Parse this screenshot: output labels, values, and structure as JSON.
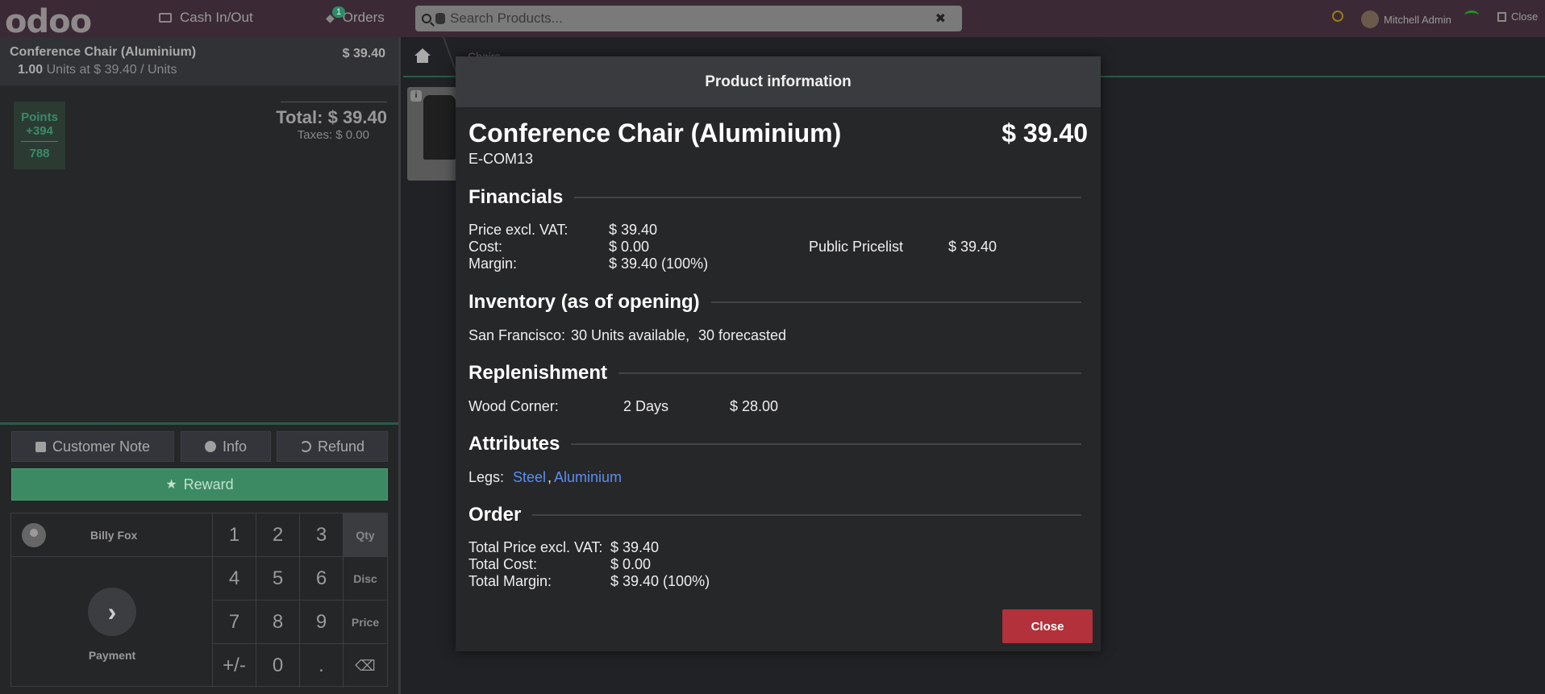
{
  "topbar": {
    "logo": "odoo",
    "cash_label": "Cash In/Out",
    "orders_label": "Orders",
    "orders_badge": "1",
    "search_placeholder": "Search Products...",
    "user_name": "Mitchell Admin",
    "close_label": "Close"
  },
  "order": {
    "line_name": "Conference Chair (Aluminium)",
    "line_price": "$ 39.40",
    "line_qty": "1.00",
    "line_detail": "Units at $ 39.40 / Units",
    "points_label": "Points",
    "points_gain": "+394",
    "points_total": "788",
    "total": "Total: $ 39.40",
    "taxes": "Taxes: $ 0.00"
  },
  "actions": {
    "customer_note": "Customer Note",
    "info": "Info",
    "refund": "Refund",
    "reward": "Reward",
    "customer": "Billy Fox",
    "payment": "Payment"
  },
  "numpad": {
    "k1": "1",
    "k2": "2",
    "k3": "3",
    "qty": "Qty",
    "k4": "4",
    "k5": "5",
    "k6": "6",
    "disc": "Disc",
    "k7": "7",
    "k8": "8",
    "k9": "9",
    "price": "Price",
    "pm": "+/-",
    "k0": "0",
    "dot": "."
  },
  "breadcrumb": {
    "item": "Chairs"
  },
  "modal": {
    "title": "Product information",
    "product_name": "Conference Chair (Aluminium)",
    "product_price": "$ 39.40",
    "product_code": "E-COM13",
    "financials": {
      "heading": "Financials",
      "price_excl_label": "Price excl. VAT:",
      "price_excl_value": "$ 39.40",
      "cost_label": "Cost:",
      "cost_value": "$ 0.00",
      "margin_label": "Margin:",
      "margin_value": "$ 39.40 (100%)",
      "pricelist_label": "Public Pricelist",
      "pricelist_value": "$ 39.40"
    },
    "inventory": {
      "heading": "Inventory (as of opening)",
      "location": "San Francisco:",
      "available": "30 Units available,",
      "forecasted": "30 forecasted"
    },
    "replenishment": {
      "heading": "Replenishment",
      "vendor": "Wood Corner:",
      "delay": "2 Days",
      "price": "$ 28.00"
    },
    "attributes": {
      "heading": "Attributes",
      "label": "Legs:",
      "value1": "Steel",
      "separator": ",",
      "value2": "Aluminium"
    },
    "order": {
      "heading": "Order",
      "total_price_label": "Total Price excl. VAT:",
      "total_price_value": "$ 39.40",
      "total_cost_label": "Total Cost:",
      "total_cost_value": "$ 0.00",
      "total_margin_label": "Total Margin:",
      "total_margin_value": "$ 39.40 (100%)"
    },
    "close_button": "Close"
  },
  "colors": {
    "topbar": "#3b2a35",
    "accent_green": "#3c8a63",
    "close_red": "#b2313a",
    "link_blue": "#5a8ef0"
  }
}
